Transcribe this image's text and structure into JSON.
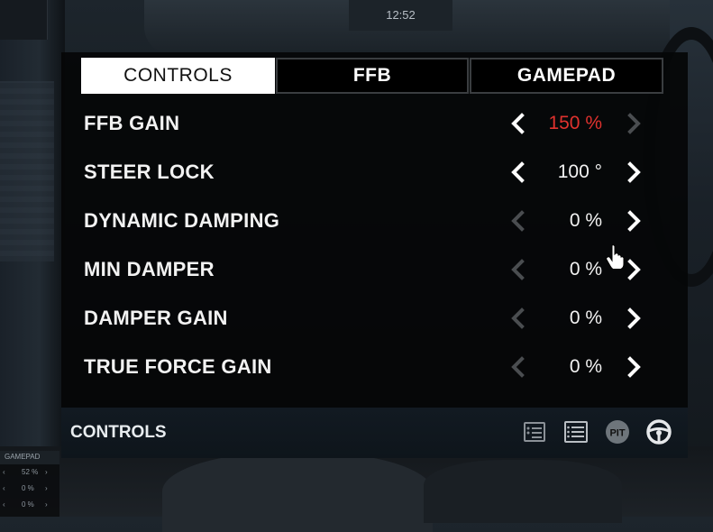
{
  "clock": "12:52",
  "tabs": [
    {
      "label": "CONTROLS",
      "active": true
    },
    {
      "label": "FFB",
      "active": false
    },
    {
      "label": "GAMEPAD",
      "active": false
    }
  ],
  "settings": [
    {
      "label": "FFB GAIN",
      "value": "150 %",
      "value_color": "#e0322e",
      "left_enabled": true,
      "right_enabled": false
    },
    {
      "label": "STEER LOCK",
      "value": "100 °",
      "value_color": "#f2f2f2",
      "left_enabled": true,
      "right_enabled": true
    },
    {
      "label": "DYNAMIC DAMPING",
      "value": "0 %",
      "value_color": "#f2f2f2",
      "left_enabled": false,
      "right_enabled": true
    },
    {
      "label": "MIN DAMPER",
      "value": "0 %",
      "value_color": "#f2f2f2",
      "left_enabled": false,
      "right_enabled": true
    },
    {
      "label": "DAMPER GAIN",
      "value": "0 %",
      "value_color": "#f2f2f2",
      "left_enabled": false,
      "right_enabled": true
    },
    {
      "label": "TRUE FORCE GAIN",
      "value": "0 %",
      "value_color": "#f2f2f2",
      "left_enabled": false,
      "right_enabled": true
    }
  ],
  "footer": {
    "title": "CONTROLS",
    "icons": [
      "setup-list-icon",
      "list-icon",
      "pit-icon",
      "steering-wheel-icon"
    ],
    "pit_label": "PIT"
  },
  "mini_widget": {
    "title": "GAMEPAD",
    "rows": [
      {
        "value": "52 %"
      },
      {
        "value": "0 %"
      },
      {
        "value": "0 %"
      }
    ]
  },
  "colors": {
    "accent_red": "#e0322e",
    "tab_active_bg": "#ffffff",
    "panel_bg": "#050607",
    "footer_bg": "#121a22"
  }
}
